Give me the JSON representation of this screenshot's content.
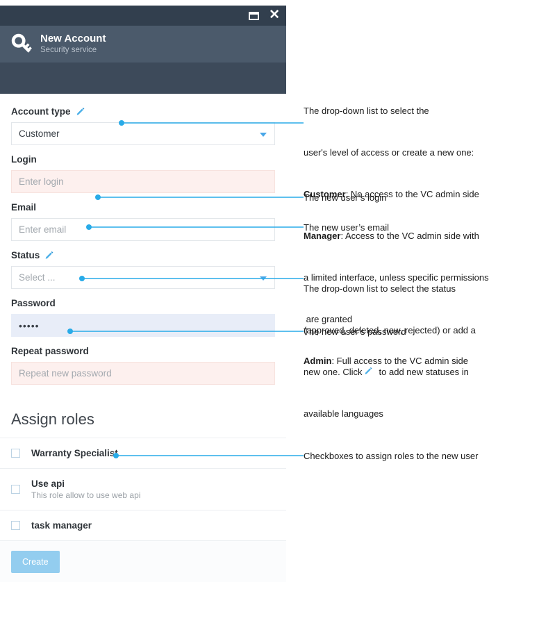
{
  "window": {
    "restore_label": "restore-window",
    "close_label": "close-window",
    "title": "New Account",
    "subtitle": "Security service",
    "icon": "key-icon"
  },
  "form": {
    "account_type": {
      "label": "Account type",
      "edit_icon": "pencil-icon",
      "value": "Customer",
      "control": "dropdown"
    },
    "login": {
      "label": "Login",
      "placeholder": "Enter login",
      "value": "",
      "state": "error"
    },
    "email": {
      "label": "Email",
      "placeholder": "Enter email",
      "value": "",
      "state": "normal"
    },
    "status": {
      "label": "Status",
      "edit_icon": "pencil-icon",
      "placeholder": "Select ...",
      "value": "",
      "control": "dropdown"
    },
    "password": {
      "label": "Password",
      "value": "•••••",
      "state": "focused"
    },
    "repeat_password": {
      "label": "Repeat password",
      "placeholder": "Repeat new password",
      "value": "",
      "state": "error"
    }
  },
  "assign_roles": {
    "title": "Assign roles",
    "roles": [
      {
        "name": "Warranty Specialist",
        "description": "",
        "checked": false
      },
      {
        "name": "Use api",
        "description": "This role allow to use web api",
        "checked": false
      },
      {
        "name": "task manager",
        "description": "",
        "checked": false
      }
    ],
    "create_label": "Create"
  },
  "annotations": {
    "account_type": {
      "line1": "The drop-down list to select the",
      "line2": "user's level of access or create a new one:",
      "customer_term": "Customer",
      "customer_text": ": No access to the VC admin side",
      "manager_term": "Manager",
      "manager_text": ": Access to the VC admin side with",
      "manager_text2": "a limited interface, unless specific permissions",
      "manager_text3": " are granted",
      "admin_term": "Admin",
      "admin_text": ": Full access to the VC admin side"
    },
    "login": "The new user’s login",
    "email": "The new user’s email",
    "status": {
      "line1": "The drop-down list to select the status",
      "line2": "(approved, deleted, new, rejected) or add a",
      "line3a": "new one. Click",
      "line3b": "to add new statuses in",
      "line4": "available languages"
    },
    "password": "The new user’s password",
    "assign_roles": "Checkboxes to assign roles to the new user"
  },
  "colors": {
    "titlebar": "#323f4e",
    "header": "#4b5a6b",
    "header_sub": "#3d4a5a",
    "accent": "#29abe8",
    "error_bg": "#fdf0ee",
    "focus_bg": "#e8edf8",
    "button": "#93cdef"
  }
}
